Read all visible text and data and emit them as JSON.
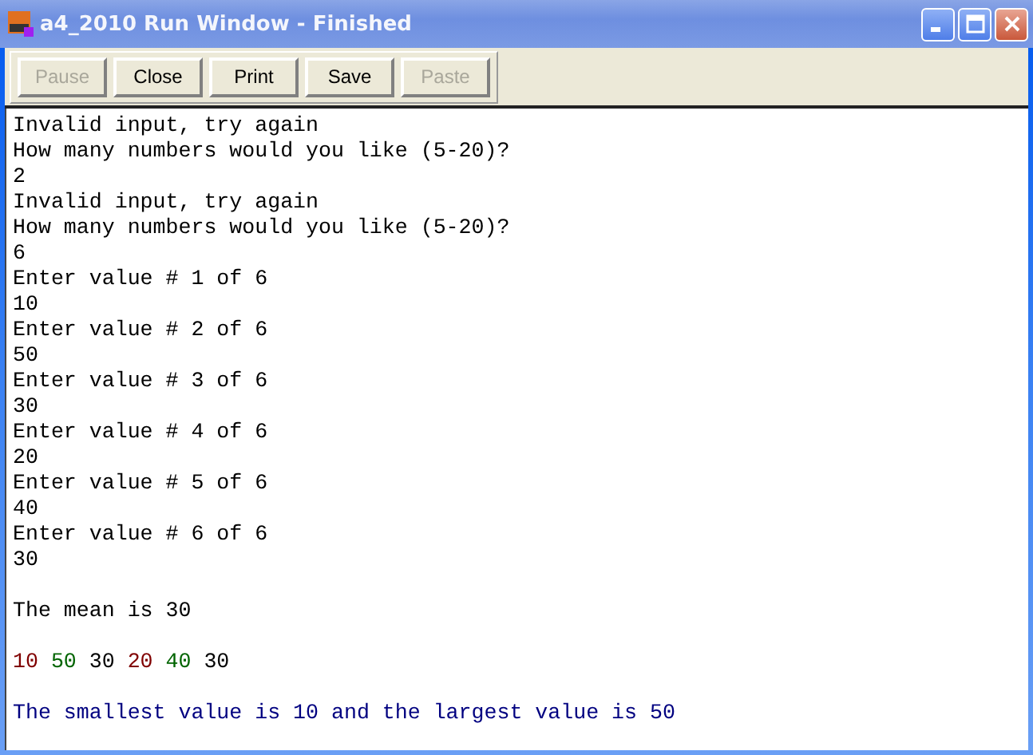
{
  "window": {
    "title": "a4_2010 Run Window - Finished"
  },
  "toolbar": [
    {
      "label": "Pause",
      "disabled": true
    },
    {
      "label": "Close",
      "disabled": false
    },
    {
      "label": "Print",
      "disabled": false
    },
    {
      "label": "Save",
      "disabled": false
    },
    {
      "label": "Paste",
      "disabled": true
    }
  ],
  "console": [
    [
      [
        {
          "text": "Invalid input, try again",
          "color": "#000000"
        }
      ],
      [
        {
          "text": "How many numbers would you like (5-20)?",
          "color": "#000000"
        }
      ],
      [
        {
          "text": "2",
          "color": "#000000"
        }
      ],
      [
        {
          "text": "Invalid input, try again",
          "color": "#000000"
        }
      ],
      [
        {
          "text": "How many numbers would you like (5-20)?",
          "color": "#000000"
        }
      ],
      [
        {
          "text": "6",
          "color": "#000000"
        }
      ],
      [
        {
          "text": "Enter value # 1 of 6",
          "color": "#000000"
        }
      ],
      [
        {
          "text": "10",
          "color": "#000000"
        }
      ],
      [
        {
          "text": "Enter value # 2 of 6",
          "color": "#000000"
        }
      ],
      [
        {
          "text": "50",
          "color": "#000000"
        }
      ],
      [
        {
          "text": "Enter value # 3 of 6",
          "color": "#000000"
        }
      ],
      [
        {
          "text": "30",
          "color": "#000000"
        }
      ],
      [
        {
          "text": "Enter value # 4 of 6",
          "color": "#000000"
        }
      ],
      [
        {
          "text": "20",
          "color": "#000000"
        }
      ],
      [
        {
          "text": "Enter value # 5 of 6",
          "color": "#000000"
        }
      ],
      [
        {
          "text": "40",
          "color": "#000000"
        }
      ],
      [
        {
          "text": "Enter value # 6 of 6",
          "color": "#000000"
        }
      ],
      [
        {
          "text": "30",
          "color": "#000000"
        }
      ]
    ],
    [
      [
        {
          "text": "The mean is 30",
          "color": "#000000"
        }
      ]
    ],
    [
      [
        {
          "text": "10",
          "color": "#800000"
        },
        {
          "text": "50",
          "color": "#006400"
        },
        {
          "text": "30",
          "color": "#000000"
        },
        {
          "text": "20",
          "color": "#800000"
        },
        {
          "text": "40",
          "color": "#006400"
        },
        {
          "text": "30",
          "color": "#000000"
        }
      ]
    ],
    [
      [
        {
          "text": "The smallest value is 10 and the largest value is 50",
          "color": "#000080"
        }
      ]
    ]
  ]
}
